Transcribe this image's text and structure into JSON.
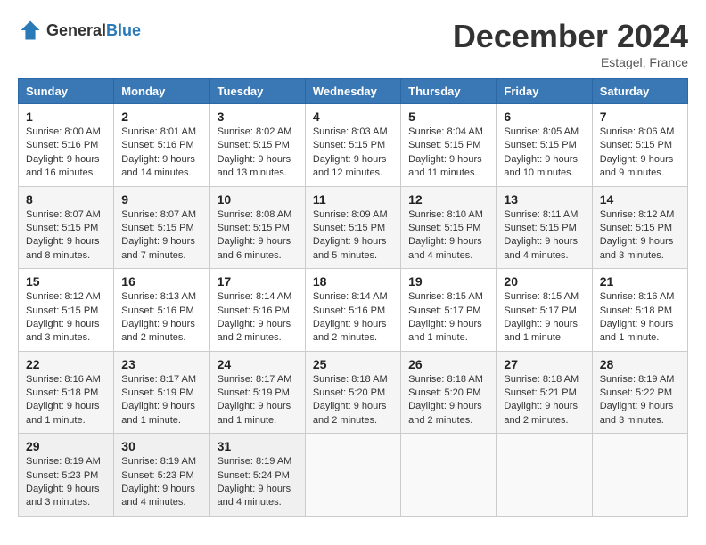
{
  "header": {
    "logo_general": "General",
    "logo_blue": "Blue",
    "month_title": "December 2024",
    "location": "Estagel, France"
  },
  "weekdays": [
    "Sunday",
    "Monday",
    "Tuesday",
    "Wednesday",
    "Thursday",
    "Friday",
    "Saturday"
  ],
  "weeks": [
    [
      {
        "day": "1",
        "sunrise": "8:00 AM",
        "sunset": "5:16 PM",
        "daylight": "9 hours and 16 minutes."
      },
      {
        "day": "2",
        "sunrise": "8:01 AM",
        "sunset": "5:16 PM",
        "daylight": "9 hours and 14 minutes."
      },
      {
        "day": "3",
        "sunrise": "8:02 AM",
        "sunset": "5:15 PM",
        "daylight": "9 hours and 13 minutes."
      },
      {
        "day": "4",
        "sunrise": "8:03 AM",
        "sunset": "5:15 PM",
        "daylight": "9 hours and 12 minutes."
      },
      {
        "day": "5",
        "sunrise": "8:04 AM",
        "sunset": "5:15 PM",
        "daylight": "9 hours and 11 minutes."
      },
      {
        "day": "6",
        "sunrise": "8:05 AM",
        "sunset": "5:15 PM",
        "daylight": "9 hours and 10 minutes."
      },
      {
        "day": "7",
        "sunrise": "8:06 AM",
        "sunset": "5:15 PM",
        "daylight": "9 hours and 9 minutes."
      }
    ],
    [
      {
        "day": "8",
        "sunrise": "8:07 AM",
        "sunset": "5:15 PM",
        "daylight": "9 hours and 8 minutes."
      },
      {
        "day": "9",
        "sunrise": "8:07 AM",
        "sunset": "5:15 PM",
        "daylight": "9 hours and 7 minutes."
      },
      {
        "day": "10",
        "sunrise": "8:08 AM",
        "sunset": "5:15 PM",
        "daylight": "9 hours and 6 minutes."
      },
      {
        "day": "11",
        "sunrise": "8:09 AM",
        "sunset": "5:15 PM",
        "daylight": "9 hours and 5 minutes."
      },
      {
        "day": "12",
        "sunrise": "8:10 AM",
        "sunset": "5:15 PM",
        "daylight": "9 hours and 4 minutes."
      },
      {
        "day": "13",
        "sunrise": "8:11 AM",
        "sunset": "5:15 PM",
        "daylight": "9 hours and 4 minutes."
      },
      {
        "day": "14",
        "sunrise": "8:12 AM",
        "sunset": "5:15 PM",
        "daylight": "9 hours and 3 minutes."
      }
    ],
    [
      {
        "day": "15",
        "sunrise": "8:12 AM",
        "sunset": "5:15 PM",
        "daylight": "9 hours and 3 minutes."
      },
      {
        "day": "16",
        "sunrise": "8:13 AM",
        "sunset": "5:16 PM",
        "daylight": "9 hours and 2 minutes."
      },
      {
        "day": "17",
        "sunrise": "8:14 AM",
        "sunset": "5:16 PM",
        "daylight": "9 hours and 2 minutes."
      },
      {
        "day": "18",
        "sunrise": "8:14 AM",
        "sunset": "5:16 PM",
        "daylight": "9 hours and 2 minutes."
      },
      {
        "day": "19",
        "sunrise": "8:15 AM",
        "sunset": "5:17 PM",
        "daylight": "9 hours and 1 minute."
      },
      {
        "day": "20",
        "sunrise": "8:15 AM",
        "sunset": "5:17 PM",
        "daylight": "9 hours and 1 minute."
      },
      {
        "day": "21",
        "sunrise": "8:16 AM",
        "sunset": "5:18 PM",
        "daylight": "9 hours and 1 minute."
      }
    ],
    [
      {
        "day": "22",
        "sunrise": "8:16 AM",
        "sunset": "5:18 PM",
        "daylight": "9 hours and 1 minute."
      },
      {
        "day": "23",
        "sunrise": "8:17 AM",
        "sunset": "5:19 PM",
        "daylight": "9 hours and 1 minute."
      },
      {
        "day": "24",
        "sunrise": "8:17 AM",
        "sunset": "5:19 PM",
        "daylight": "9 hours and 1 minute."
      },
      {
        "day": "25",
        "sunrise": "8:18 AM",
        "sunset": "5:20 PM",
        "daylight": "9 hours and 2 minutes."
      },
      {
        "day": "26",
        "sunrise": "8:18 AM",
        "sunset": "5:20 PM",
        "daylight": "9 hours and 2 minutes."
      },
      {
        "day": "27",
        "sunrise": "8:18 AM",
        "sunset": "5:21 PM",
        "daylight": "9 hours and 2 minutes."
      },
      {
        "day": "28",
        "sunrise": "8:19 AM",
        "sunset": "5:22 PM",
        "daylight": "9 hours and 3 minutes."
      }
    ],
    [
      {
        "day": "29",
        "sunrise": "8:19 AM",
        "sunset": "5:23 PM",
        "daylight": "9 hours and 3 minutes."
      },
      {
        "day": "30",
        "sunrise": "8:19 AM",
        "sunset": "5:23 PM",
        "daylight": "9 hours and 4 minutes."
      },
      {
        "day": "31",
        "sunrise": "8:19 AM",
        "sunset": "5:24 PM",
        "daylight": "9 hours and 4 minutes."
      },
      null,
      null,
      null,
      null
    ]
  ],
  "labels": {
    "sunrise": "Sunrise:",
    "sunset": "Sunset:",
    "daylight": "Daylight:"
  }
}
